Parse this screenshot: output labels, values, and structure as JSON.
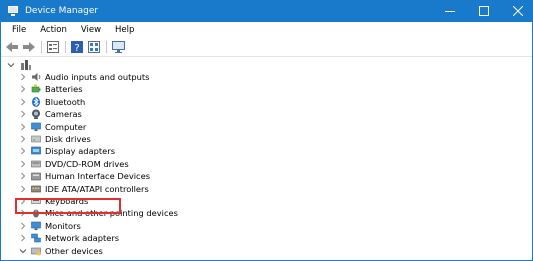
{
  "window": {
    "title": "Device Manager"
  },
  "menu": [
    "File",
    "Action",
    "View",
    "Help"
  ],
  "toolbar": [
    "back-icon",
    "forward-icon",
    "properties-icon",
    "help-icon",
    "view-icon",
    "monitor-icon"
  ],
  "colors": {
    "titlebar": "#1979ca",
    "highlight": "#e03030"
  },
  "devices": [
    {
      "label": "Audio inputs and outputs",
      "icon": "speaker-icon",
      "expanded": false
    },
    {
      "label": "Batteries",
      "icon": "battery-icon",
      "expanded": false
    },
    {
      "label": "Bluetooth",
      "icon": "bluetooth-icon",
      "expanded": false
    },
    {
      "label": "Cameras",
      "icon": "camera-icon",
      "expanded": false
    },
    {
      "label": "Computer",
      "icon": "computer-icon",
      "expanded": false
    },
    {
      "label": "Disk drives",
      "icon": "disk-icon",
      "expanded": false
    },
    {
      "label": "Display adapters",
      "icon": "display-adapter-icon",
      "expanded": false,
      "highlighted": true
    },
    {
      "label": "DVD/CD-ROM drives",
      "icon": "dvd-icon",
      "expanded": false
    },
    {
      "label": "Human Interface Devices",
      "icon": "hid-icon",
      "expanded": false
    },
    {
      "label": "IDE ATA/ATAPI controllers",
      "icon": "ide-icon",
      "expanded": false
    },
    {
      "label": "Keyboards",
      "icon": "keyboard-icon",
      "expanded": false
    },
    {
      "label": "Mice and other pointing devices",
      "icon": "mouse-icon",
      "expanded": false
    },
    {
      "label": "Monitors",
      "icon": "monitor-icon",
      "expanded": false
    },
    {
      "label": "Network adapters",
      "icon": "network-icon",
      "expanded": false
    },
    {
      "label": "Other devices",
      "icon": "other-devices-icon",
      "expanded": true
    }
  ]
}
